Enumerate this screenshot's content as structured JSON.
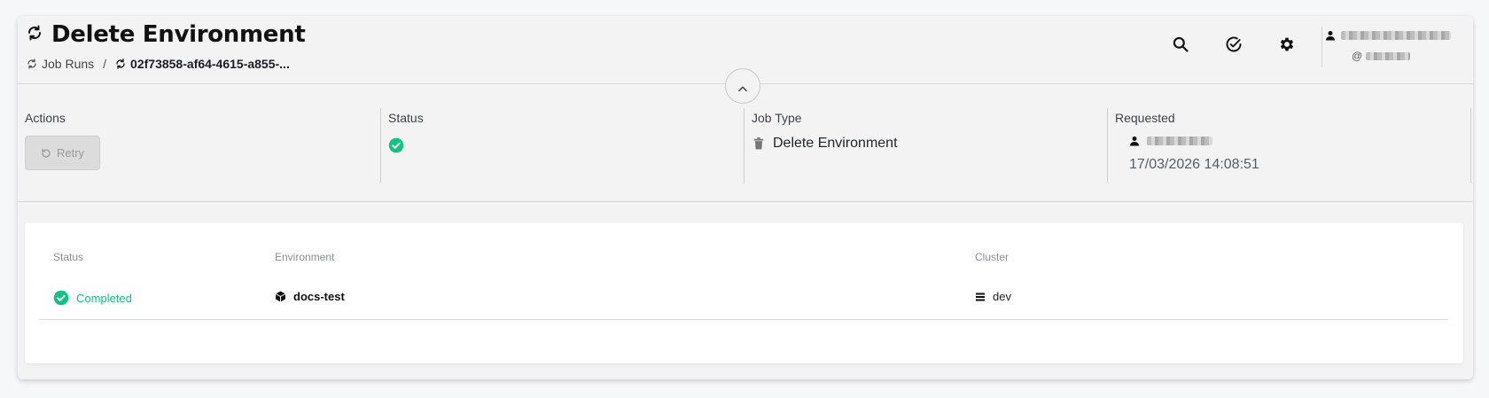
{
  "header": {
    "title": "Delete Environment",
    "breadcrumb": {
      "parent": "Job Runs",
      "separator": "/",
      "current": "02f73858-af64-4615-a855-..."
    },
    "actions": [
      "search-icon",
      "check-circle-icon",
      "gear-icon"
    ],
    "user": {
      "handle_prefix": "@"
    }
  },
  "info": {
    "actions": {
      "label": "Actions",
      "retry_label": "Retry"
    },
    "status": {
      "label": "Status",
      "icon": "check-circle-icon"
    },
    "job_type": {
      "label": "Job Type",
      "value": "Delete Environment",
      "icon": "trash-icon"
    },
    "requested": {
      "label": "Requested",
      "timestamp": "17/03/2026 14:08:51"
    }
  },
  "table": {
    "columns": [
      "Status",
      "Environment",
      "Cluster"
    ],
    "rows": [
      {
        "status": "Completed",
        "environment": "docs-test",
        "cluster": "dev"
      }
    ]
  },
  "colors": {
    "success": "#10c383",
    "card_bg": "#f3f3f3",
    "panel_bg": "#ffffff"
  }
}
